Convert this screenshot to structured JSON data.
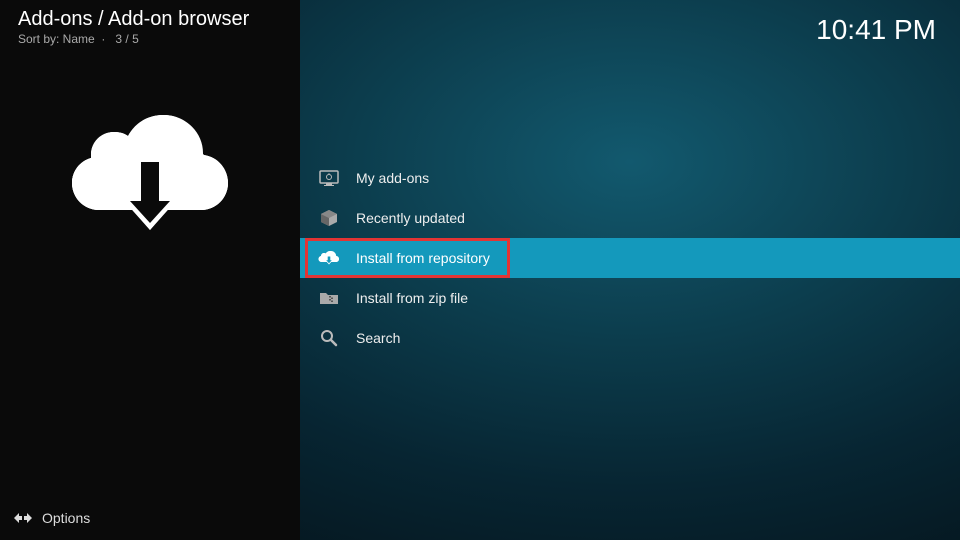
{
  "header": {
    "title": "Add-ons / Add-on browser",
    "sort_label": "Sort by: Name",
    "position": "3 / 5"
  },
  "clock": "10:41 PM",
  "menu": {
    "items": [
      {
        "label": "My add-ons",
        "icon": "monitor-icon",
        "selected": false
      },
      {
        "label": "Recently updated",
        "icon": "box-icon",
        "selected": false
      },
      {
        "label": "Install from repository",
        "icon": "cloud-download-icon",
        "selected": true
      },
      {
        "label": "Install from zip file",
        "icon": "zip-folder-icon",
        "selected": false
      },
      {
        "label": "Search",
        "icon": "search-icon",
        "selected": false
      }
    ]
  },
  "footer": {
    "options_label": "Options"
  }
}
